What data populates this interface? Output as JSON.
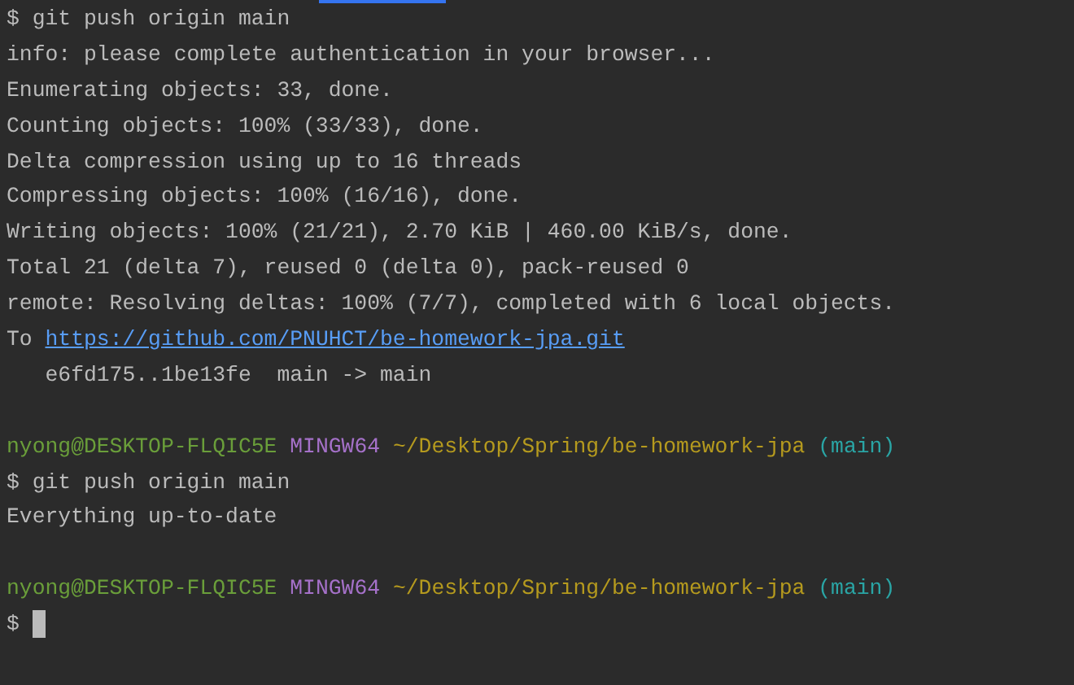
{
  "terminal": {
    "lines": [
      {
        "kind": "command",
        "text": "$ git push origin main"
      },
      {
        "kind": "output",
        "text": "info: please complete authentication in your browser..."
      },
      {
        "kind": "output",
        "text": "Enumerating objects: 33, done."
      },
      {
        "kind": "output",
        "text": "Counting objects: 100% (33/33), done."
      },
      {
        "kind": "output",
        "text": "Delta compression using up to 16 threads"
      },
      {
        "kind": "output",
        "text": "Compressing objects: 100% (16/16), done."
      },
      {
        "kind": "output",
        "text": "Writing objects: 100% (21/21), 2.70 KiB | 460.00 KiB/s, done."
      },
      {
        "kind": "output",
        "text": "Total 21 (delta 7), reused 0 (delta 0), pack-reused 0"
      },
      {
        "kind": "output",
        "text": "remote: Resolving deltas: 100% (7/7), completed with 6 local objects."
      },
      {
        "kind": "link",
        "text": "To",
        "url": "https://github.com/PNUHCT/be-homework-jpa.git"
      },
      {
        "kind": "output",
        "text": "   e6fd175..1be13fe  main -> main"
      },
      {
        "kind": "blank"
      },
      {
        "kind": "prompt",
        "user": "nyong@DESKTOP-FLQIC5E",
        "system": "MINGW64",
        "path": "~/Desktop/Spring/be-homework-jpa",
        "branch": "(main)"
      },
      {
        "kind": "command",
        "text": "$ git push origin main"
      },
      {
        "kind": "output",
        "text": "Everything up-to-date"
      },
      {
        "kind": "blank"
      },
      {
        "kind": "prompt",
        "user": "nyong@DESKTOP-FLQIC5E",
        "system": "MINGW64",
        "path": "~/Desktop/Spring/be-homework-jpa",
        "branch": "(main)"
      },
      {
        "kind": "input",
        "text": "$"
      }
    ]
  }
}
